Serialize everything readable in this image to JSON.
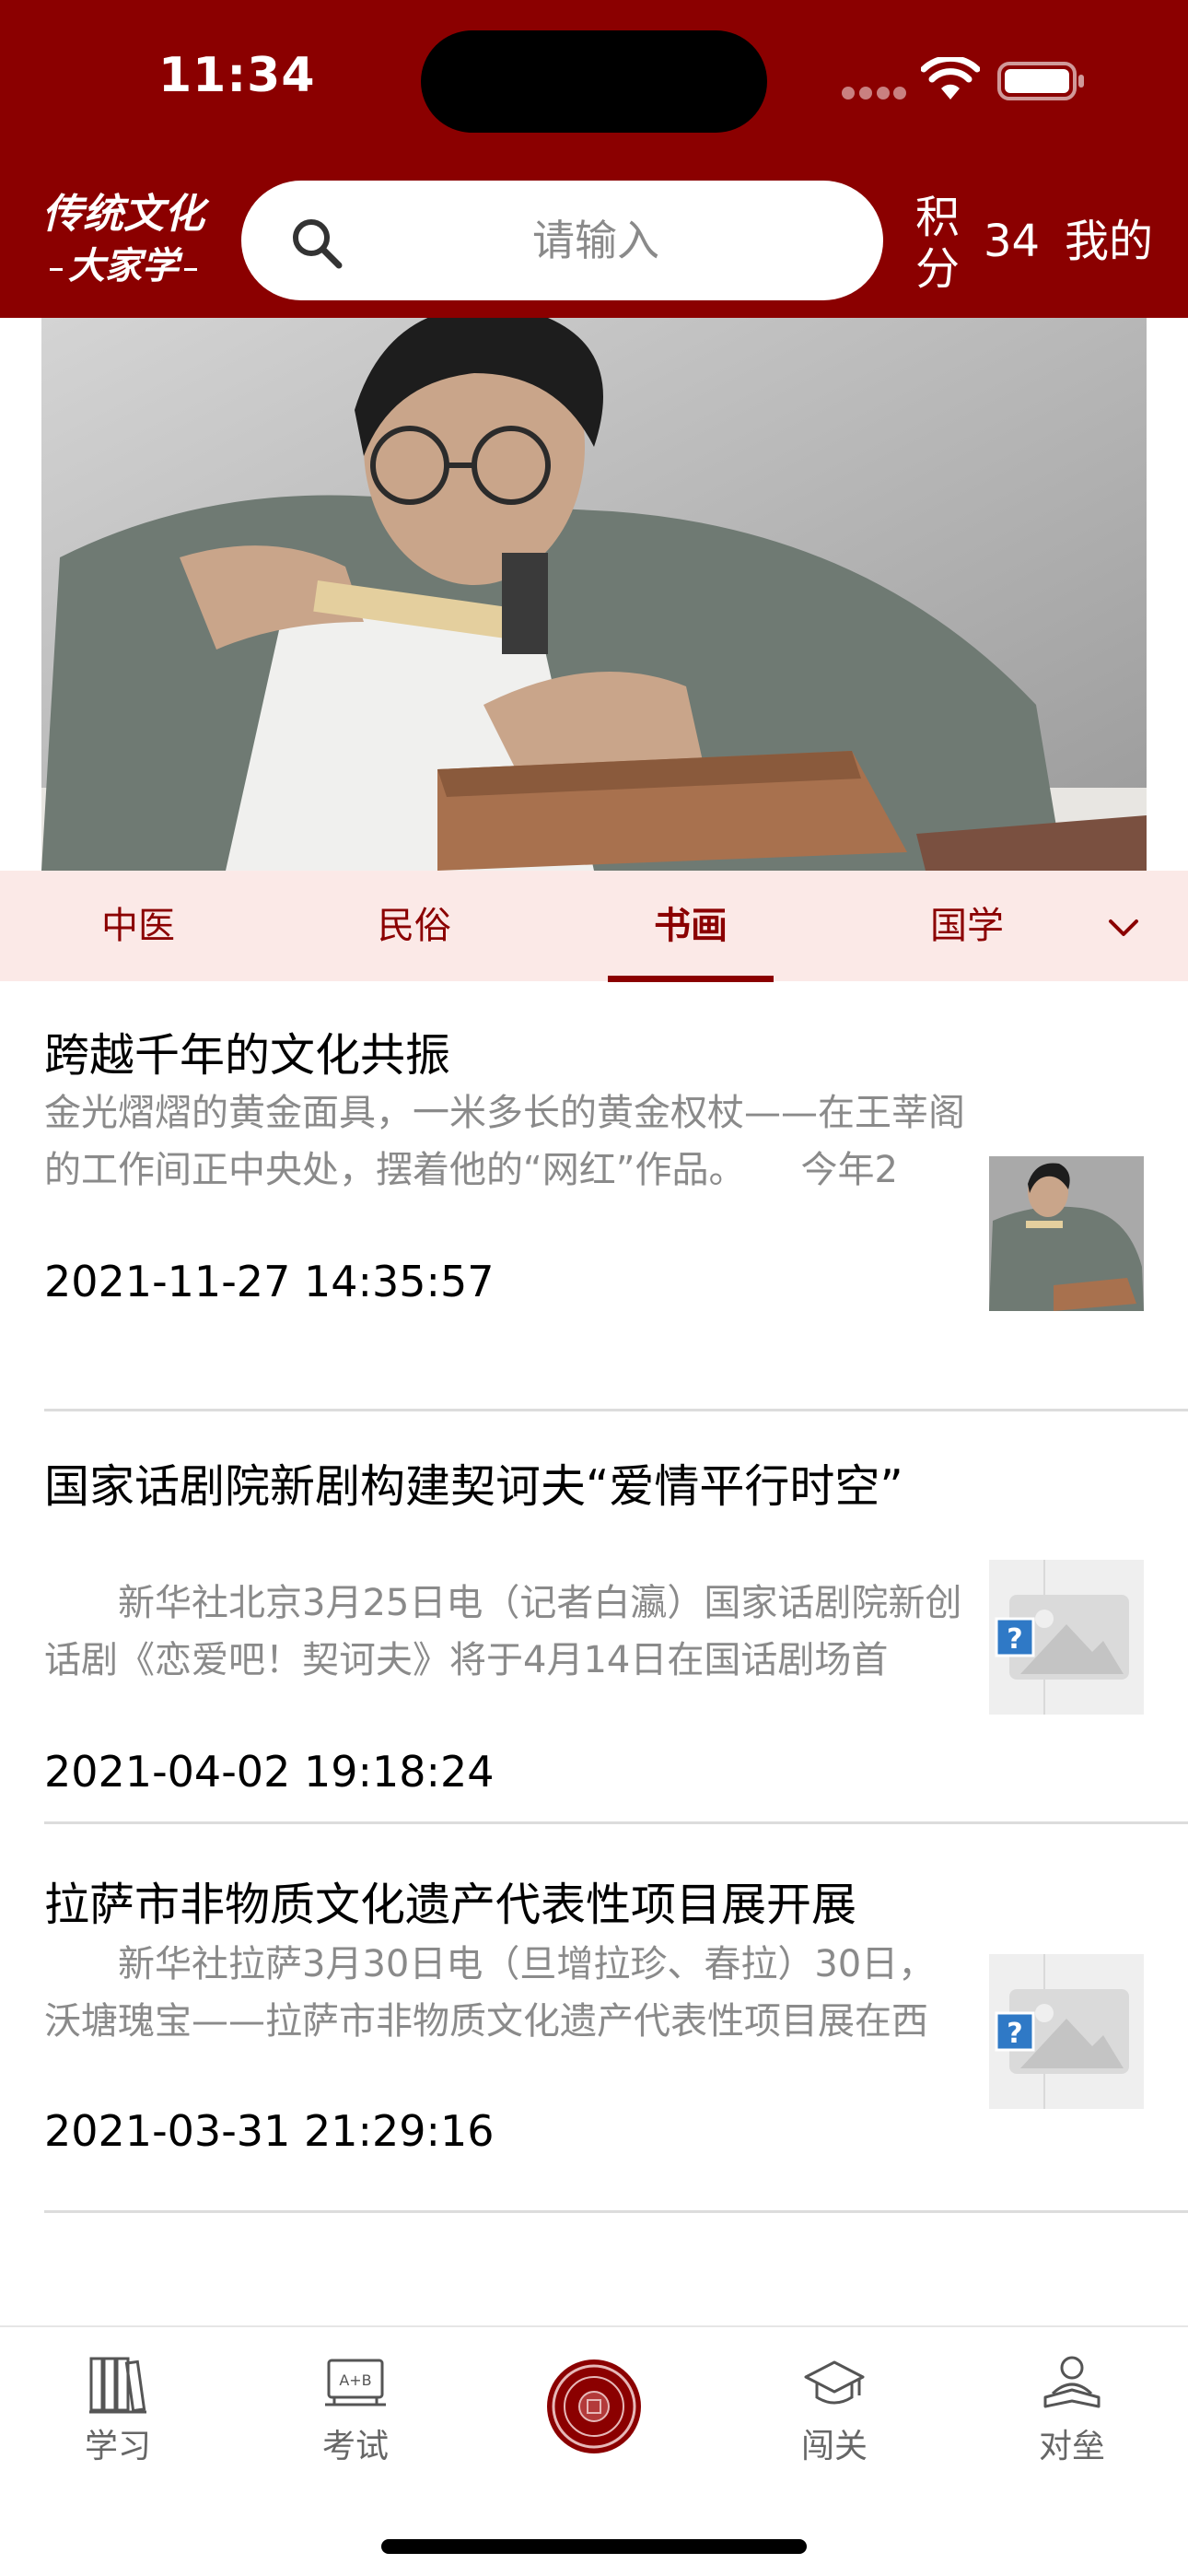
{
  "status_bar": {
    "time": "11:34"
  },
  "header": {
    "logo_line1": "传统文化",
    "logo_line2": "大家学",
    "search_placeholder": "请输入",
    "points_label": "积分",
    "points_value": "34",
    "mine_label": "我的"
  },
  "tabs": [
    {
      "label": "中医",
      "active": false
    },
    {
      "label": "民俗",
      "active": false
    },
    {
      "label": "书画",
      "active": true
    },
    {
      "label": "国学",
      "active": false
    }
  ],
  "news": [
    {
      "title": "跨越千年的文化共振",
      "summary": "金光熠熠的黄金面具，一米多长的黄金权杖——在王莘阁的工作间正中央处，摆着他的“网红”作品。　　今年2",
      "date": "2021-11-27 14:35:57",
      "thumb": "photo"
    },
    {
      "title": "国家话剧院新剧构建契诃夫“爱情平行时空”",
      "summary": "　　新华社北京3月25日电（记者白瀛）国家话剧院新创话剧《恋爱吧！契诃夫》将于4月14日在国话剧场首",
      "date": "2021-04-02 19:18:24",
      "thumb": "placeholder"
    },
    {
      "title": "拉萨市非物质文化遗产代表性项目展开展",
      "summary": "　　新华社拉萨3月30日电（旦增拉珍、春拉）30日，沃塘瑰宝——拉萨市非物质文化遗产代表性项目展在西",
      "date": "2021-03-31 21:29:16",
      "thumb": "placeholder"
    }
  ],
  "bottom_nav": [
    {
      "label": "学习",
      "icon": "books-icon"
    },
    {
      "label": "考试",
      "icon": "exam-board-icon"
    },
    {
      "label": "",
      "icon": "emblem-icon"
    },
    {
      "label": "闯关",
      "icon": "graduation-cap-icon"
    },
    {
      "label": "对垒",
      "icon": "reader-icon"
    }
  ],
  "colors": {
    "brand": "#8b0000",
    "tab_bg": "#fbe9e7",
    "muted_text": "#8a8a8a"
  }
}
